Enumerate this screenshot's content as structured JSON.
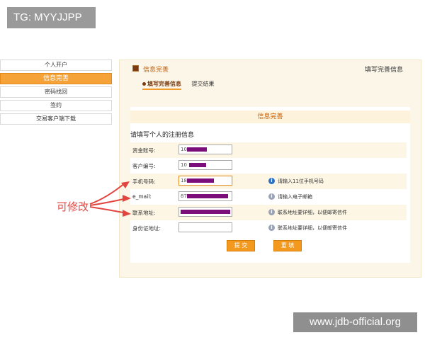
{
  "watermarks": {
    "top_left": "TG: MYYJJPP",
    "bottom_right": "www.jdb-official.org"
  },
  "menu": {
    "items": [
      {
        "label": "个人开户",
        "active": false
      },
      {
        "label": "信息完善",
        "active": true
      },
      {
        "label": "密码找回",
        "active": false
      },
      {
        "label": "签约",
        "active": false
      },
      {
        "label": "交易客户端下载",
        "active": false
      }
    ]
  },
  "panel": {
    "title": "信息完善",
    "right_title": "填写完善信息",
    "steps": [
      "填写完善信息",
      "提交结果"
    ]
  },
  "form": {
    "heading": "信息完善",
    "subtitle": "请填写个人的注册信息",
    "fields": [
      {
        "label": "资金账号:",
        "value": "10",
        "hint": ""
      },
      {
        "label": "客户编号:",
        "value": "10",
        "hint": ""
      },
      {
        "label": "手机号码:",
        "value": "18",
        "hint": "请输入11位手机号码",
        "hint_icon": "info-icon"
      },
      {
        "label": "e_mail:",
        "value": "87",
        "hint": "请输入电子邮箱",
        "hint_icon": "info-icon"
      },
      {
        "label": "联系地址:",
        "value": "",
        "hint": "联系地址要详细，以便邮寄信件",
        "hint_icon": "info-icon"
      },
      {
        "label": "身份证地址:",
        "value": "",
        "hint": "联系地址要详细，以便邮寄信件",
        "hint_icon": "info-icon"
      }
    ],
    "submit_label": "提 交",
    "reset_label": "重 填"
  },
  "annotation": {
    "text": "可修改",
    "color": "#e2453f"
  },
  "colors": {
    "accent": "#f5a338",
    "redaction": "#7b0e7b",
    "title": "#c55a00"
  }
}
